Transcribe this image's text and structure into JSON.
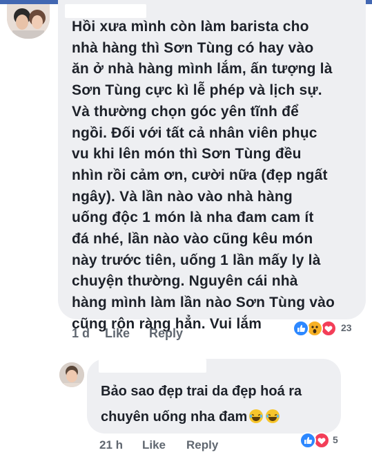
{
  "comment1": {
    "author_name": "",
    "text": "Hồi xưa mình còn làm barista cho\nnhà hàng thì Sơn Tùng có hay vào\năn ở nhà hàng mình lắm, ấn tượng là\nSơn Tùng cực kì lễ phép và lịch sự.\nVà thường chọn góc yên tĩnh để\nngồi. Đối với tất cả nhân viên phục\nvu khi lên món thì Sơn Tùng đều\nnhìn rồi cảm ơn, cười nữa (đẹp ngất\nngây). Và lần nào vào nhà hàng\nuống độc 1 món là nha đam cam ít\nđá nhé, lần nào vào cũng kêu món\nnày trước tiên, uống 1 lần mấy ly là\nchuyện thường. Nguyên cái nhà\nhàng mình làm lần nào Sơn Tùng vào\ncũng rộn ràng hẳn. Vui lắm",
    "time": "1 d",
    "like_label": "Like",
    "reply_label": "Reply",
    "reactions": [
      "like",
      "wow",
      "love"
    ],
    "reaction_count": "23"
  },
  "comment2": {
    "author_name": "",
    "text": "Bảo sao đẹp trai da đẹp hoá ra\nchuyên uống nha đam",
    "emojis": [
      "laughing-emoji",
      "laughing-emoji"
    ],
    "time": "21 h",
    "like_label": "Like",
    "reply_label": "Reply",
    "reactions": [
      "like",
      "love"
    ],
    "reaction_count": "5"
  },
  "colors": {
    "bubble": "#eeeff2",
    "text": "#1d2129",
    "meta": "#606770",
    "like": "#2d88ff",
    "love": "#f33e58",
    "wow": "#f7b125",
    "header": "#4267b2"
  }
}
